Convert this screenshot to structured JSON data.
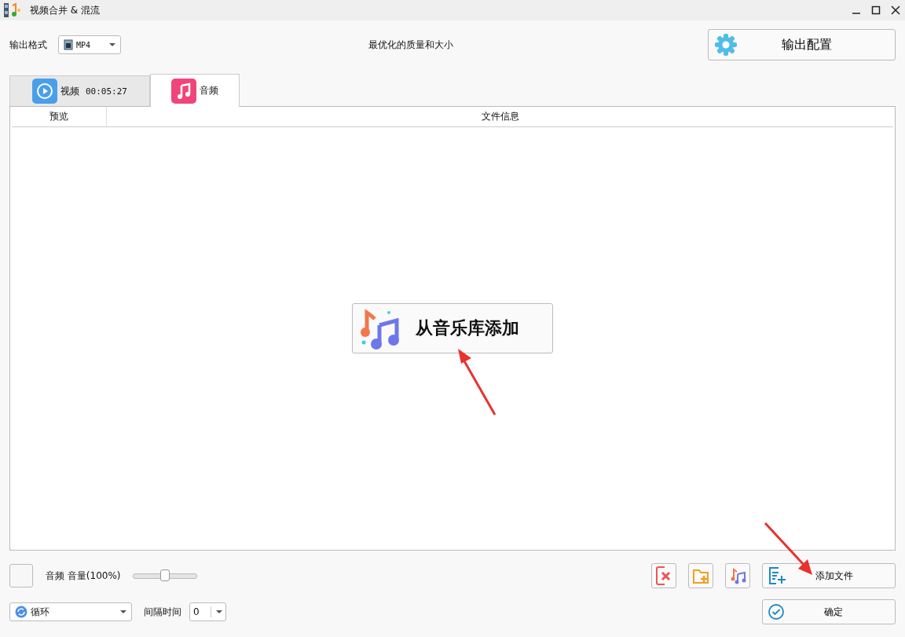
{
  "window": {
    "title": "视频合并 & 混流"
  },
  "output": {
    "label": "输出格式",
    "format": "MP4",
    "quality": "最优化的质量和大小",
    "config_button": "输出配置"
  },
  "tabs": [
    {
      "kind": "video",
      "label": "视频",
      "duration": "00:05:27",
      "selected": false
    },
    {
      "kind": "audio",
      "label": "音频",
      "selected": true
    }
  ],
  "table": {
    "columns": [
      "预览",
      "文件信息"
    ],
    "library_button": "从音乐库添加"
  },
  "volume": {
    "label": "音频 音量(100%)",
    "level": 0.5
  },
  "mode": {
    "value": "循环",
    "interval_label": "间隔时间",
    "interval": "0"
  },
  "buttons": {
    "add_file": "添加文件",
    "ok": "确定"
  }
}
